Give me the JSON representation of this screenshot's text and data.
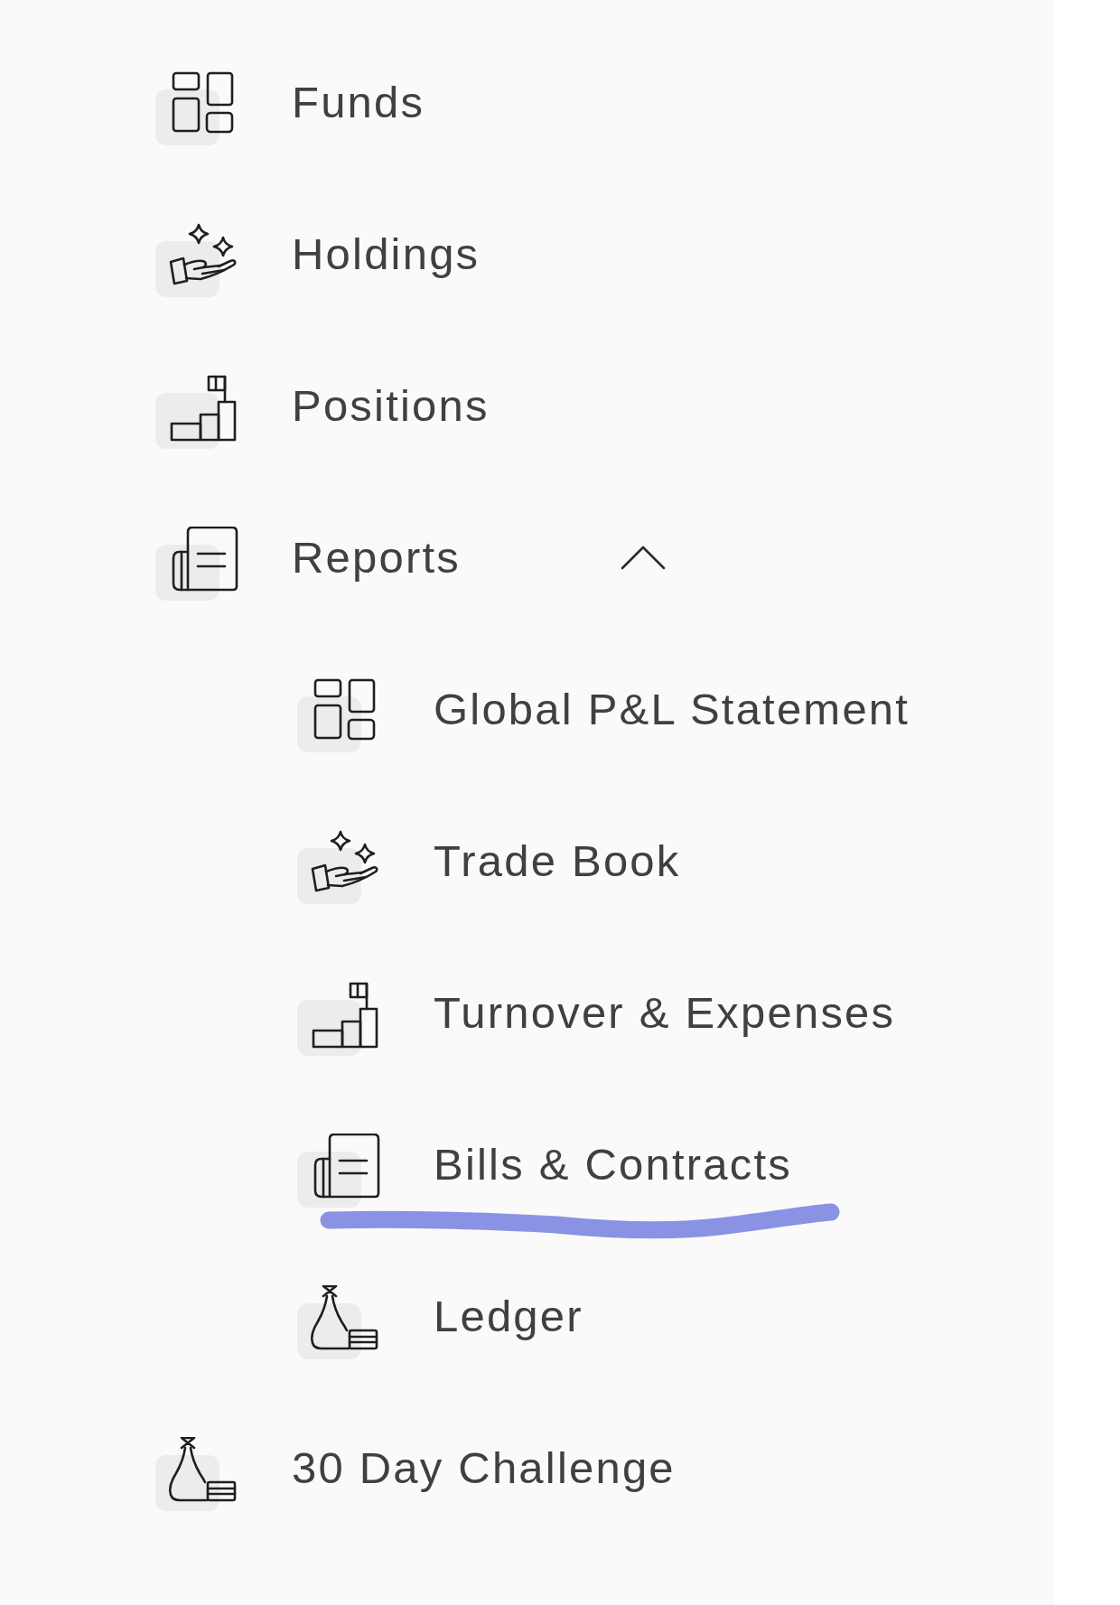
{
  "sidebar": {
    "items": [
      {
        "label": "Funds"
      },
      {
        "label": "Holdings"
      },
      {
        "label": "Positions"
      },
      {
        "label": "Reports",
        "expanded": true,
        "children": [
          {
            "label": "Global P&L Statement"
          },
          {
            "label": "Trade Book"
          },
          {
            "label": "Turnover & Expenses"
          },
          {
            "label": "Bills & Contracts"
          },
          {
            "label": "Ledger"
          }
        ]
      },
      {
        "label": "30 Day Challenge"
      }
    ]
  }
}
